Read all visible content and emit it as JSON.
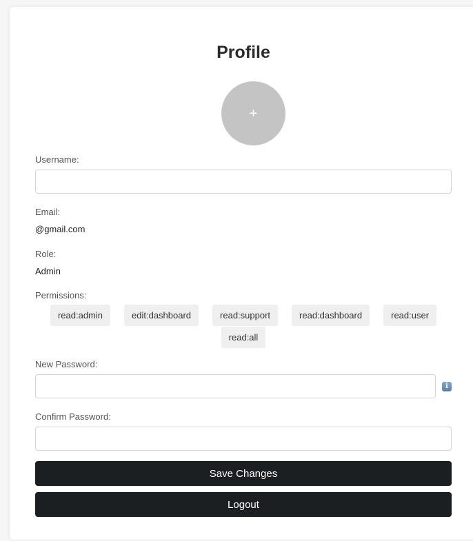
{
  "profile": {
    "title": "Profile",
    "avatar_icon": "plus-icon",
    "avatar_symbol": "+",
    "username": {
      "label": "Username:",
      "value": "",
      "placeholder": ""
    },
    "email": {
      "label": "Email:",
      "value": "@gmail.com"
    },
    "role": {
      "label": "Role:",
      "value": "Admin"
    },
    "permissions": {
      "label": "Permissions:",
      "items": [
        "read:admin",
        "edit:dashboard",
        "read:support",
        "read:dashboard",
        "read:user",
        "read:all"
      ]
    },
    "new_password": {
      "label": "New Password:",
      "value": "",
      "info_icon": "info-icon",
      "info_symbol": "i"
    },
    "confirm_password": {
      "label": "Confirm Password:",
      "value": ""
    },
    "save_label": "Save Changes",
    "logout_label": "Logout"
  },
  "colors": {
    "button_bg": "#1c1f21",
    "avatar_bg": "#c4c4c4",
    "chip_bg": "#efefef"
  }
}
